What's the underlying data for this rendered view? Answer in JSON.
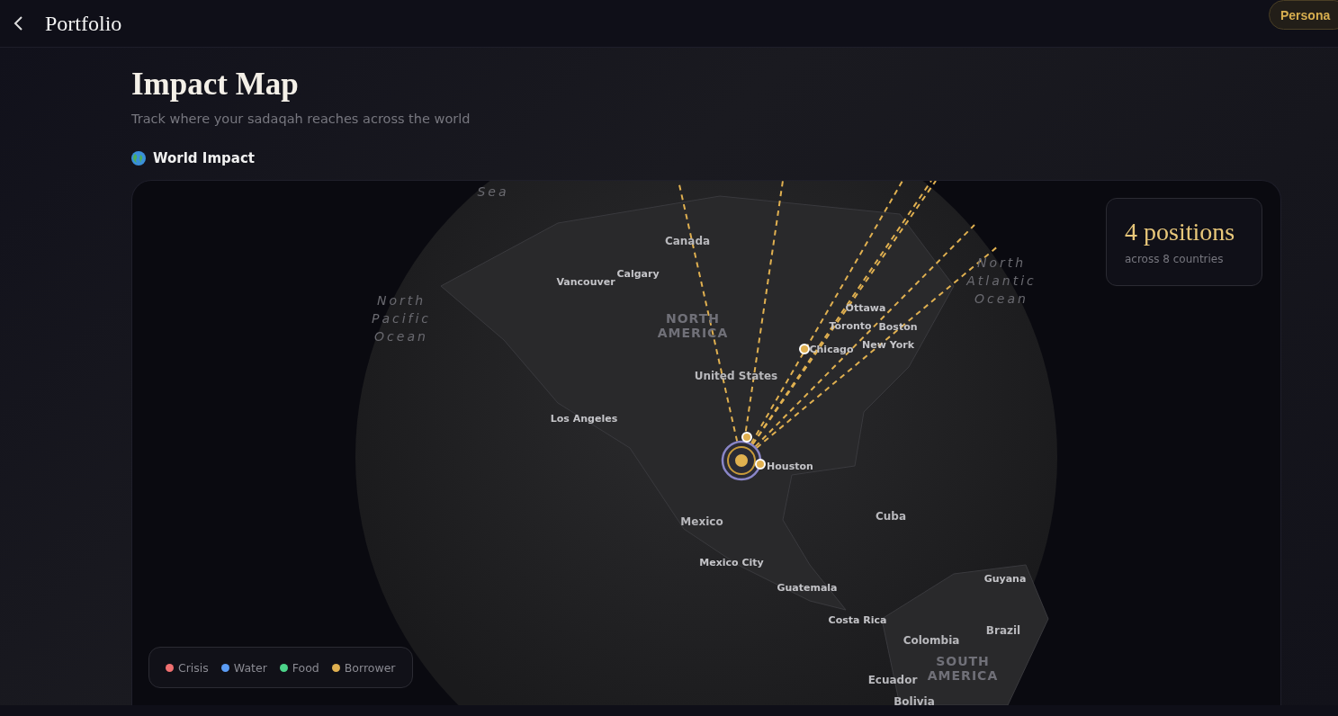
{
  "header": {
    "title": "Portfolio",
    "pill": "Persona"
  },
  "page": {
    "title": "Impact Map",
    "subtitle": "Track where your sadaqah reaches across the world",
    "section": "World Impact"
  },
  "map": {
    "labels": [
      {
        "text": "Sea",
        "kind": "ocean"
      },
      {
        "text": "Canada",
        "kind": "country"
      },
      {
        "text": "Calgary",
        "kind": "city"
      },
      {
        "text": "Vancouver",
        "kind": "city"
      },
      {
        "text": "North Pacific Ocean",
        "kind": "ocean"
      },
      {
        "text": "NORTH AMERICA",
        "kind": "region"
      },
      {
        "text": "Ottawa",
        "kind": "city"
      },
      {
        "text": "Toronto",
        "kind": "city"
      },
      {
        "text": "Boston",
        "kind": "city"
      },
      {
        "text": "New York",
        "kind": "city"
      },
      {
        "text": "Chicago",
        "kind": "city"
      },
      {
        "text": "United States",
        "kind": "country"
      },
      {
        "text": "Los Angeles",
        "kind": "city"
      },
      {
        "text": "Houston",
        "kind": "city"
      },
      {
        "text": "Mexico",
        "kind": "country"
      },
      {
        "text": "Cuba",
        "kind": "country"
      },
      {
        "text": "Mexico City",
        "kind": "city"
      },
      {
        "text": "Guatemala",
        "kind": "city"
      },
      {
        "text": "Costa Rica",
        "kind": "city"
      },
      {
        "text": "Guyana",
        "kind": "city"
      },
      {
        "text": "Brazil",
        "kind": "country"
      },
      {
        "text": "Colombia",
        "kind": "country"
      },
      {
        "text": "Ecuador",
        "kind": "country"
      },
      {
        "text": "SOUTH AMERICA",
        "kind": "region"
      },
      {
        "text": "Bolivia",
        "kind": "country"
      },
      {
        "text": "North Atlantic Ocean",
        "kind": "ocean"
      }
    ],
    "stats": {
      "value": "4 positions",
      "caption": "across 8 countries"
    },
    "legend": [
      {
        "label": "Crisis",
        "color": "#f07070"
      },
      {
        "label": "Water",
        "color": "#5b9cf5"
      },
      {
        "label": "Food",
        "color": "#4cd48a"
      },
      {
        "label": "Borrower",
        "color": "#e0b050"
      }
    ]
  }
}
